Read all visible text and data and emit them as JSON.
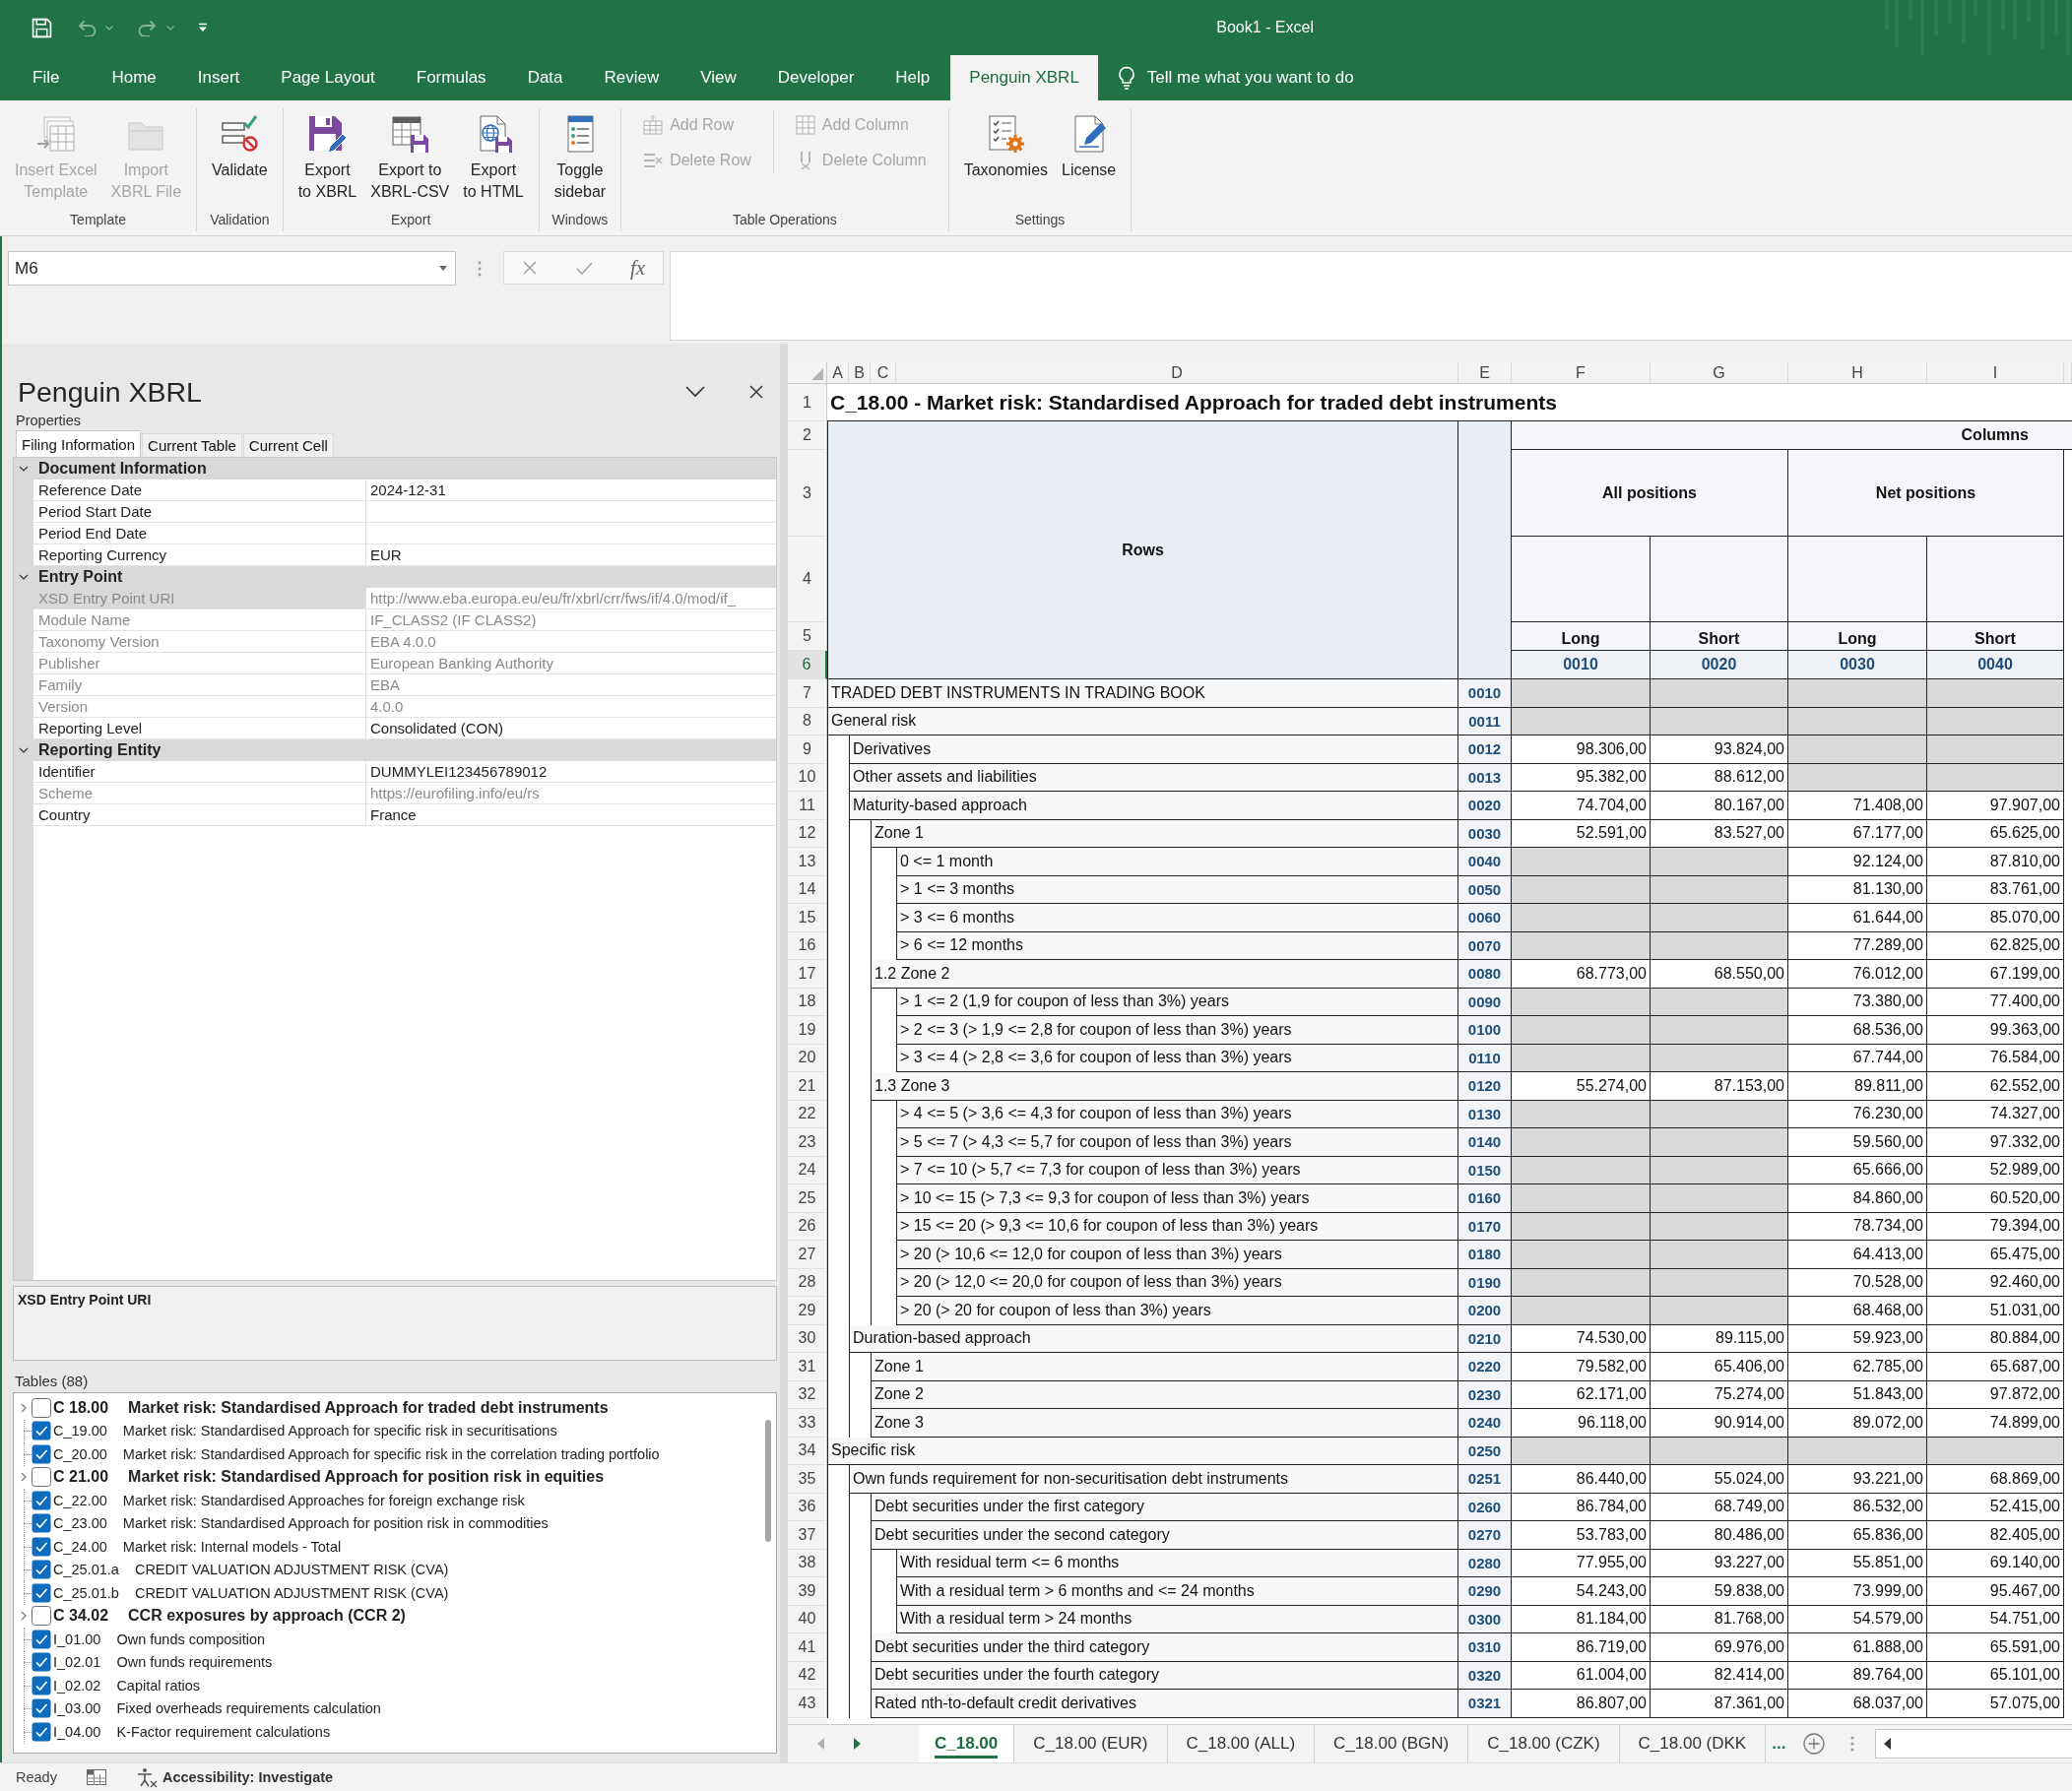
{
  "title_bar": {
    "title": "Book1 - Excel",
    "quick_access": [
      {
        "kind": "save",
        "disabled": false
      },
      {
        "kind": "undo",
        "disabled": true
      },
      {
        "kind": "redo",
        "disabled": true
      },
      {
        "kind": "customize",
        "disabled": false
      }
    ]
  },
  "ribbon": {
    "tabs": [
      {
        "label": "File",
        "selected": false
      },
      {
        "label": "Home",
        "selected": false
      },
      {
        "label": "Insert",
        "selected": false
      },
      {
        "label": "Page Layout",
        "selected": false
      },
      {
        "label": "Formulas",
        "selected": false
      },
      {
        "label": "Data",
        "selected": false
      },
      {
        "label": "Review",
        "selected": false
      },
      {
        "label": "View",
        "selected": false
      },
      {
        "label": "Developer",
        "selected": false
      },
      {
        "label": "Help",
        "selected": false
      },
      {
        "label": "Penguin XBRL",
        "selected": true
      }
    ],
    "tell_me": "Tell me what you want to do",
    "groups": [
      {
        "label": "Template",
        "buttons": [
          {
            "kind": "insert",
            "lines": [
              "Insert Excel",
              "Template"
            ],
            "disabled": true
          },
          {
            "kind": "import",
            "lines": [
              "Import",
              "XBRL File"
            ],
            "disabled": true
          }
        ]
      },
      {
        "label": "Validation",
        "buttons": [
          {
            "kind": "validate",
            "lines": [
              "Validate"
            ],
            "disabled": false
          }
        ]
      },
      {
        "label": "Export",
        "buttons": [
          {
            "kind": "xbrl",
            "lines": [
              "Export",
              "to XBRL"
            ],
            "disabled": false
          },
          {
            "kind": "csv",
            "lines": [
              "Export to",
              "XBRL-CSV"
            ],
            "disabled": false
          },
          {
            "kind": "html",
            "lines": [
              "Export",
              "to HTML"
            ],
            "disabled": false
          }
        ]
      },
      {
        "label": "Windows",
        "buttons": [
          {
            "kind": "sidebar",
            "lines": [
              "Toggle",
              "sidebar"
            ],
            "disabled": false
          }
        ]
      },
      {
        "label": "Table Operations",
        "buttons": [
          {
            "kind": "addrow",
            "lines": [
              "Add Row"
            ],
            "disabled": true
          },
          {
            "kind": "deleterow",
            "lines": [
              "Delete Row"
            ],
            "disabled": true
          },
          {
            "kind": "addcolumn",
            "lines": [
              "Add Column"
            ],
            "disabled": true
          },
          {
            "kind": "deletecolumn",
            "lines": [
              "Delete Column"
            ],
            "disabled": true
          }
        ]
      },
      {
        "label": "Settings",
        "buttons": [
          {
            "kind": "taxonomies",
            "lines": [
              "Taxonomies"
            ],
            "disabled": false
          },
          {
            "kind": "license",
            "lines": [
              "License"
            ],
            "disabled": false
          }
        ]
      }
    ]
  },
  "formula_bar": {
    "name_box": "M6",
    "function_button": "fx"
  },
  "panel": {
    "title": "Penguin XBRL",
    "subtitle": "Properties",
    "tabs": [
      {
        "label": "Filing Information",
        "selected": true
      },
      {
        "label": "Current Table",
        "selected": false
      },
      {
        "label": "Current Cell",
        "selected": false
      }
    ],
    "categories": [
      {
        "name": "Document Information",
        "expanded": true,
        "children": [
          {
            "name": "Reference Date",
            "value": "2024-12-31",
            "readonly": false,
            "selected": false
          },
          {
            "name": "Period Start Date",
            "readonly": false,
            "selected": false
          },
          {
            "name": "Period End Date",
            "readonly": false,
            "selected": false
          },
          {
            "name": "Reporting Currency",
            "value": "EUR",
            "readonly": false,
            "selected": false
          }
        ]
      },
      {
        "name": "Entry Point",
        "expanded": true,
        "children": [
          {
            "name": "XSD Entry Point URI",
            "value": "http://www.eba.europa.eu/eu/fr/xbrl/crr/fws/if/4.0/mod/if_",
            "readonly": true,
            "selected": true
          },
          {
            "name": "Module Name",
            "value": "IF_CLASS2 (IF CLASS2)",
            "readonly": true,
            "selected": false
          },
          {
            "name": "Taxonomy Version",
            "value": "EBA 4.0.0",
            "readonly": true,
            "selected": false
          },
          {
            "name": "Publisher",
            "value": "European Banking Authority",
            "readonly": true,
            "selected": false
          },
          {
            "name": "Family",
            "value": "EBA",
            "readonly": true,
            "selected": false
          },
          {
            "name": "Version",
            "value": "4.0.0",
            "readonly": true,
            "selected": false
          },
          {
            "name": "Reporting Level",
            "value": "Consolidated (CON)",
            "readonly": false,
            "selected": false
          }
        ]
      },
      {
        "name": "Reporting Entity",
        "expanded": true,
        "children": [
          {
            "name": "Identifier",
            "value": "DUMMYLEI123456789012",
            "readonly": false,
            "selected": false
          },
          {
            "name": "Scheme",
            "value": "https://eurofiling.info/eu/rs",
            "readonly": true,
            "selected": false
          },
          {
            "name": "Country",
            "value": "France",
            "readonly": false,
            "selected": false
          }
        ]
      }
    ],
    "description": "XSD Entry Point URI",
    "tables_label": "Tables (88)",
    "tables": [
      {
        "kind": "group",
        "code": "C 18.00",
        "title": "Market risk: Standardised Approach for traded debt instruments",
        "checked": false,
        "expanded": false
      },
      {
        "kind": "table",
        "code": "C_19.00",
        "title": "Market risk: Standardised Approach for specific risk in securitisations",
        "checked": true
      },
      {
        "kind": "table",
        "code": "C_20.00",
        "title": "Market risk: Standardised Approach for specific risk in the correlation trading portfolio",
        "checked": true
      },
      {
        "kind": "group",
        "code": "C 21.00",
        "title": "Market risk: Standardised Approach for position risk in equities",
        "checked": false,
        "expanded": false
      },
      {
        "kind": "table",
        "code": "C_22.00",
        "title": "Market risk: Standardised Approaches for foreign exchange risk",
        "checked": true
      },
      {
        "kind": "table",
        "code": "C_23.00",
        "title": "Market risk: Standardised Approach for position risk in commodities",
        "checked": true
      },
      {
        "kind": "table",
        "code": "C_24.00",
        "title": "Market risk: Internal models - Total",
        "checked": true
      },
      {
        "kind": "table",
        "code": "C_25.01.a",
        "title": "CREDIT VALUATION ADJUSTMENT RISK (CVA)",
        "checked": true
      },
      {
        "kind": "table",
        "code": "C_25.01.b",
        "title": "CREDIT VALUATION ADJUSTMENT RISK (CVA)",
        "checked": true
      },
      {
        "kind": "group",
        "code": "C 34.02",
        "title": "CCR exposures by approach (CCR 2)",
        "checked": false,
        "expanded": false
      },
      {
        "kind": "table",
        "code": "I_01.00",
        "title": "Own funds composition",
        "checked": true
      },
      {
        "kind": "table",
        "code": "I_02.01",
        "title": "Own funds requirements",
        "checked": true
      },
      {
        "kind": "table",
        "code": "I_02.02",
        "title": "Capital ratios",
        "checked": true
      },
      {
        "kind": "table",
        "code": "I_03.00",
        "title": "Fixed overheads requirements calculation",
        "checked": true
      },
      {
        "kind": "table",
        "code": "I_04.00",
        "title": "K-Factor requirement calculations",
        "checked": true
      }
    ]
  },
  "sheet": {
    "column_headers": [
      "A",
      "B",
      "C",
      "D",
      "E",
      "F",
      "G",
      "H",
      "I"
    ],
    "row_headers": [
      {
        "label": "1",
        "selected": false
      },
      {
        "label": "2",
        "selected": false
      },
      {
        "label": "3",
        "selected": false
      },
      {
        "label": "4",
        "selected": false
      },
      {
        "label": "5",
        "selected": false
      },
      {
        "label": "6",
        "selected": true
      },
      {
        "label": "7",
        "selected": false
      },
      {
        "label": "8",
        "selected": false
      },
      {
        "label": "9",
        "selected": false
      },
      {
        "label": "10",
        "selected": false
      },
      {
        "label": "11",
        "selected": false
      },
      {
        "label": "12",
        "selected": false
      },
      {
        "label": "13",
        "selected": false
      },
      {
        "label": "14",
        "selected": false
      },
      {
        "label": "15",
        "selected": false
      },
      {
        "label": "16",
        "selected": false
      },
      {
        "label": "17",
        "selected": false
      },
      {
        "label": "18",
        "selected": false
      },
      {
        "label": "19",
        "selected": false
      },
      {
        "label": "20",
        "selected": false
      },
      {
        "label": "21",
        "selected": false
      },
      {
        "label": "22",
        "selected": false
      },
      {
        "label": "23",
        "selected": false
      },
      {
        "label": "24",
        "selected": false
      },
      {
        "label": "25",
        "selected": false
      },
      {
        "label": "26",
        "selected": false
      },
      {
        "label": "27",
        "selected": false
      },
      {
        "label": "28",
        "selected": false
      },
      {
        "label": "29",
        "selected": false
      },
      {
        "label": "30",
        "selected": false
      },
      {
        "label": "31",
        "selected": false
      },
      {
        "label": "32",
        "selected": false
      },
      {
        "label": "33",
        "selected": false
      },
      {
        "label": "34",
        "selected": false
      },
      {
        "label": "35",
        "selected": false
      },
      {
        "label": "36",
        "selected": false
      },
      {
        "label": "37",
        "selected": false
      },
      {
        "label": "38",
        "selected": false
      },
      {
        "label": "39",
        "selected": false
      },
      {
        "label": "40",
        "selected": false
      },
      {
        "label": "41",
        "selected": false
      },
      {
        "label": "42",
        "selected": false
      },
      {
        "label": "43",
        "selected": false
      }
    ],
    "title": "C_18.00 - Market risk: Standardised Approach for traded debt instruments",
    "rows_header": "Rows",
    "columns_header": "Columns",
    "column_groups": [
      "All positions",
      "Net positions"
    ],
    "column_labels": [
      "Long",
      "Short",
      "Long",
      "Short"
    ],
    "column_codes": [
      "0010",
      "0020",
      "0030",
      "0040"
    ],
    "rows": [
      {
        "label": "TRADED DEBT INSTRUMENTS IN TRADING BOOK",
        "code": "0010",
        "cells": [
          {
            "shaded": true
          },
          {
            "shaded": true
          },
          {
            "shaded": true
          },
          {
            "shaded": true
          }
        ]
      },
      {
        "label": "General risk",
        "code": "0011",
        "cells": [
          {
            "shaded": true
          },
          {
            "shaded": true
          },
          {
            "shaded": true
          },
          {
            "shaded": true
          }
        ],
        "children": [
          {
            "label": "Derivatives",
            "code": "0012",
            "cells": [
              {
                "value": "98.306,00",
                "shaded": false
              },
              {
                "value": "93.824,00",
                "shaded": false
              },
              {
                "shaded": true
              },
              {
                "shaded": true
              }
            ]
          },
          {
            "label": "Other assets and liabilities",
            "code": "0013",
            "cells": [
              {
                "value": "95.382,00",
                "shaded": false
              },
              {
                "value": "88.612,00",
                "shaded": false
              },
              {
                "shaded": true
              },
              {
                "shaded": true
              }
            ]
          },
          {
            "label": "Maturity-based approach",
            "code": "0020",
            "cells": [
              {
                "value": "74.704,00",
                "shaded": false
              },
              {
                "value": "80.167,00",
                "shaded": false
              },
              {
                "value": "71.408,00",
                "shaded": false
              },
              {
                "value": "97.907,00",
                "shaded": false
              }
            ],
            "children": [
              {
                "label": "Zone 1",
                "code": "0030",
                "cells": [
                  {
                    "value": "52.591,00",
                    "shaded": false
                  },
                  {
                    "value": "83.527,00",
                    "shaded": false
                  },
                  {
                    "value": "67.177,00",
                    "shaded": false
                  },
                  {
                    "value": "65.625,00",
                    "shaded": false
                  }
                ],
                "children": [
                  {
                    "label": "0 <= 1 month",
                    "code": "0040",
                    "cells": [
                      {
                        "shaded": true
                      },
                      {
                        "shaded": true
                      },
                      {
                        "value": "92.124,00",
                        "shaded": false
                      },
                      {
                        "value": "87.810,00",
                        "shaded": false
                      }
                    ]
                  },
                  {
                    "label": "> 1 <= 3 months",
                    "code": "0050",
                    "cells": [
                      {
                        "shaded": true
                      },
                      {
                        "shaded": true
                      },
                      {
                        "value": "81.130,00",
                        "shaded": false
                      },
                      {
                        "value": "83.761,00",
                        "shaded": false
                      }
                    ]
                  },
                  {
                    "label": "> 3 <= 6 months",
                    "code": "0060",
                    "cells": [
                      {
                        "shaded": true
                      },
                      {
                        "shaded": true
                      },
                      {
                        "value": "61.644,00",
                        "shaded": false
                      },
                      {
                        "value": "85.070,00",
                        "shaded": false
                      }
                    ]
                  },
                  {
                    "label": "> 6 <= 12 months",
                    "code": "0070",
                    "cells": [
                      {
                        "shaded": true
                      },
                      {
                        "shaded": true
                      },
                      {
                        "value": "77.289,00",
                        "shaded": false
                      },
                      {
                        "value": "62.825,00",
                        "shaded": false
                      }
                    ]
                  }
                ]
              },
              {
                "label": "1.2 Zone 2",
                "code": "0080",
                "cells": [
                  {
                    "value": "68.773,00",
                    "shaded": false
                  },
                  {
                    "value": "68.550,00",
                    "shaded": false
                  },
                  {
                    "value": "76.012,00",
                    "shaded": false
                  },
                  {
                    "value": "67.199,00",
                    "shaded": false
                  }
                ],
                "children": [
                  {
                    "label": "> 1 <= 2 (1,9 for coupon of less than 3%) years",
                    "code": "0090",
                    "cells": [
                      {
                        "shaded": true
                      },
                      {
                        "shaded": true
                      },
                      {
                        "value": "73.380,00",
                        "shaded": false
                      },
                      {
                        "value": "77.400,00",
                        "shaded": false
                      }
                    ]
                  },
                  {
                    "label": "> 2 <= 3 (> 1,9 <= 2,8 for coupon of less than 3%) years",
                    "code": "0100",
                    "cells": [
                      {
                        "shaded": true
                      },
                      {
                        "shaded": true
                      },
                      {
                        "value": "68.536,00",
                        "shaded": false
                      },
                      {
                        "value": "99.363,00",
                        "shaded": false
                      }
                    ]
                  },
                  {
                    "label": "> 3 <= 4 (> 2,8 <= 3,6 for coupon of less than 3%) years",
                    "code": "0110",
                    "cells": [
                      {
                        "shaded": true
                      },
                      {
                        "shaded": true
                      },
                      {
                        "value": "67.744,00",
                        "shaded": false
                      },
                      {
                        "value": "76.584,00",
                        "shaded": false
                      }
                    ]
                  }
                ]
              },
              {
                "label": "1.3 Zone 3",
                "code": "0120",
                "cells": [
                  {
                    "value": "55.274,00",
                    "shaded": false
                  },
                  {
                    "value": "87.153,00",
                    "shaded": false
                  },
                  {
                    "value": "89.811,00",
                    "shaded": false
                  },
                  {
                    "value": "62.552,00",
                    "shaded": false
                  }
                ],
                "children": [
                  {
                    "label": "> 4 <= 5 (> 3,6 <= 4,3 for coupon of less than 3%) years",
                    "code": "0130",
                    "cells": [
                      {
                        "shaded": true
                      },
                      {
                        "shaded": true
                      },
                      {
                        "value": "76.230,00",
                        "shaded": false
                      },
                      {
                        "value": "74.327,00",
                        "shaded": false
                      }
                    ]
                  },
                  {
                    "label": "> 5 <= 7 (> 4,3 <= 5,7 for coupon of less than 3%) years",
                    "code": "0140",
                    "cells": [
                      {
                        "shaded": true
                      },
                      {
                        "shaded": true
                      },
                      {
                        "value": "59.560,00",
                        "shaded": false
                      },
                      {
                        "value": "97.332,00",
                        "shaded": false
                      }
                    ]
                  },
                  {
                    "label": "> 7 <= 10 (> 5,7 <= 7,3 for coupon of less than 3%) years",
                    "code": "0150",
                    "cells": [
                      {
                        "shaded": true
                      },
                      {
                        "shaded": true
                      },
                      {
                        "value": "65.666,00",
                        "shaded": false
                      },
                      {
                        "value": "52.989,00",
                        "shaded": false
                      }
                    ]
                  },
                  {
                    "label": "> 10 <= 15 (> 7,3 <= 9,3 for coupon of less than 3%) years",
                    "code": "0160",
                    "cells": [
                      {
                        "shaded": true
                      },
                      {
                        "shaded": true
                      },
                      {
                        "value": "84.860,00",
                        "shaded": false
                      },
                      {
                        "value": "60.520,00",
                        "shaded": false
                      }
                    ]
                  },
                  {
                    "label": "> 15 <= 20 (> 9,3 <= 10,6 for coupon of less than 3%) years",
                    "code": "0170",
                    "cells": [
                      {
                        "shaded": true
                      },
                      {
                        "shaded": true
                      },
                      {
                        "value": "78.734,00",
                        "shaded": false
                      },
                      {
                        "value": "79.394,00",
                        "shaded": false
                      }
                    ]
                  },
                  {
                    "label": "> 20 (> 10,6 <= 12,0 for coupon of less than 3%) years",
                    "code": "0180",
                    "cells": [
                      {
                        "shaded": true
                      },
                      {
                        "shaded": true
                      },
                      {
                        "value": "64.413,00",
                        "shaded": false
                      },
                      {
                        "value": "65.475,00",
                        "shaded": false
                      }
                    ]
                  },
                  {
                    "label": "> 20 (> 12,0 <= 20,0 for coupon of less than 3%) years",
                    "code": "0190",
                    "cells": [
                      {
                        "shaded": true
                      },
                      {
                        "shaded": true
                      },
                      {
                        "value": "70.528,00",
                        "shaded": false
                      },
                      {
                        "value": "92.460,00",
                        "shaded": false
                      }
                    ]
                  },
                  {
                    "label": "> 20 (> 20 for coupon of less than 3%) years",
                    "code": "0200",
                    "cells": [
                      {
                        "shaded": true
                      },
                      {
                        "shaded": true
                      },
                      {
                        "value": "68.468,00",
                        "shaded": false
                      },
                      {
                        "value": "51.031,00",
                        "shaded": false
                      }
                    ]
                  }
                ]
              }
            ]
          },
          {
            "label": "Duration-based approach",
            "code": "0210",
            "cells": [
              {
                "value": "74.530,00",
                "shaded": false
              },
              {
                "value": "89.115,00",
                "shaded": false
              },
              {
                "value": "59.923,00",
                "shaded": false
              },
              {
                "value": "80.884,00",
                "shaded": false
              }
            ],
            "children": [
              {
                "label": "Zone 1",
                "code": "0220",
                "cells": [
                  {
                    "value": "79.582,00",
                    "shaded": false
                  },
                  {
                    "value": "65.406,00",
                    "shaded": false
                  },
                  {
                    "value": "62.785,00",
                    "shaded": false
                  },
                  {
                    "value": "65.687,00",
                    "shaded": false
                  }
                ]
              },
              {
                "label": "Zone 2",
                "code": "0230",
                "cells": [
                  {
                    "value": "62.171,00",
                    "shaded": false
                  },
                  {
                    "value": "75.274,00",
                    "shaded": false
                  },
                  {
                    "value": "51.843,00",
                    "shaded": false
                  },
                  {
                    "value": "97.872,00",
                    "shaded": false
                  }
                ]
              },
              {
                "label": "Zone 3",
                "code": "0240",
                "cells": [
                  {
                    "value": "96.118,00",
                    "shaded": false
                  },
                  {
                    "value": "90.914,00",
                    "shaded": false
                  },
                  {
                    "value": "89.072,00",
                    "shaded": false
                  },
                  {
                    "value": "74.899,00",
                    "shaded": false
                  }
                ]
              }
            ]
          }
        ]
      },
      {
        "label": "Specific risk",
        "code": "0250",
        "cells": [
          {
            "shaded": true
          },
          {
            "shaded": true
          },
          {
            "shaded": true
          },
          {
            "shaded": true
          }
        ],
        "children": [
          {
            "label": "Own funds requirement for non-securitisation debt instruments",
            "code": "0251",
            "cells": [
              {
                "value": "86.440,00",
                "shaded": false
              },
              {
                "value": "55.024,00",
                "shaded": false
              },
              {
                "value": "93.221,00",
                "shaded": false
              },
              {
                "value": "68.869,00",
                "shaded": false
              }
            ],
            "children": [
              {
                "label": "Debt securities under the first category",
                "code": "0260",
                "cells": [
                  {
                    "value": "86.784,00",
                    "shaded": false
                  },
                  {
                    "value": "68.749,00",
                    "shaded": false
                  },
                  {
                    "value": "86.532,00",
                    "shaded": false
                  },
                  {
                    "value": "52.415,00",
                    "shaded": false
                  }
                ]
              },
              {
                "label": "Debt securities under the second category",
                "code": "0270",
                "cells": [
                  {
                    "value": "53.783,00",
                    "shaded": false
                  },
                  {
                    "value": "80.486,00",
                    "shaded": false
                  },
                  {
                    "value": "65.836,00",
                    "shaded": false
                  },
                  {
                    "value": "82.405,00",
                    "shaded": false
                  }
                ],
                "children": [
                  {
                    "label": "With residual term <= 6 months",
                    "code": "0280",
                    "cells": [
                      {
                        "value": "77.955,00",
                        "shaded": false
                      },
                      {
                        "value": "93.227,00",
                        "shaded": false
                      },
                      {
                        "value": "55.851,00",
                        "shaded": false
                      },
                      {
                        "value": "69.140,00",
                        "shaded": false
                      }
                    ]
                  },
                  {
                    "label": "With a residual term > 6 months and <= 24 months",
                    "code": "0290",
                    "cells": [
                      {
                        "value": "54.243,00",
                        "shaded": false
                      },
                      {
                        "value": "59.838,00",
                        "shaded": false
                      },
                      {
                        "value": "73.999,00",
                        "shaded": false
                      },
                      {
                        "value": "95.467,00",
                        "shaded": false
                      }
                    ]
                  },
                  {
                    "label": "With a residual term > 24 months",
                    "code": "0300",
                    "cells": [
                      {
                        "value": "81.184,00",
                        "shaded": false
                      },
                      {
                        "value": "81.768,00",
                        "shaded": false
                      },
                      {
                        "value": "54.579,00",
                        "shaded": false
                      },
                      {
                        "value": "54.751,00",
                        "shaded": false
                      }
                    ]
                  }
                ]
              },
              {
                "label": "Debt securities under the third category",
                "code": "0310",
                "cells": [
                  {
                    "value": "86.719,00",
                    "shaded": false
                  },
                  {
                    "value": "69.976,00",
                    "shaded": false
                  },
                  {
                    "value": "61.888,00",
                    "shaded": false
                  },
                  {
                    "value": "65.591,00",
                    "shaded": false
                  }
                ]
              },
              {
                "label": "Debt securities under the fourth category",
                "code": "0320",
                "cells": [
                  {
                    "value": "61.004,00",
                    "shaded": false
                  },
                  {
                    "value": "82.414,00",
                    "shaded": false
                  },
                  {
                    "value": "89.764,00",
                    "shaded": false
                  },
                  {
                    "value": "65.101,00",
                    "shaded": false
                  }
                ]
              },
              {
                "label": "Rated nth-to-default credit derivatives",
                "code": "0321",
                "cells": [
                  {
                    "value": "86.807,00",
                    "shaded": false
                  },
                  {
                    "value": "87.361,00",
                    "shaded": false
                  },
                  {
                    "value": "68.037,00",
                    "shaded": false
                  },
                  {
                    "value": "57.075,00",
                    "shaded": false
                  }
                ]
              }
            ]
          }
        ]
      }
    ]
  },
  "sheet_tabs": {
    "tabs": [
      {
        "label": "C_18.00",
        "selected": true
      },
      {
        "label": "C_18.00 (EUR)",
        "selected": false
      },
      {
        "label": "C_18.00 (ALL)",
        "selected": false
      },
      {
        "label": "C_18.00 (BGN)",
        "selected": false
      },
      {
        "label": "C_18.00 (CZK)",
        "selected": false
      },
      {
        "label": "C_18.00 (DKK",
        "selected": false
      }
    ],
    "more": "..."
  },
  "status_bar": {
    "status": "Ready",
    "accessibility": "Accessibility: Investigate"
  }
}
